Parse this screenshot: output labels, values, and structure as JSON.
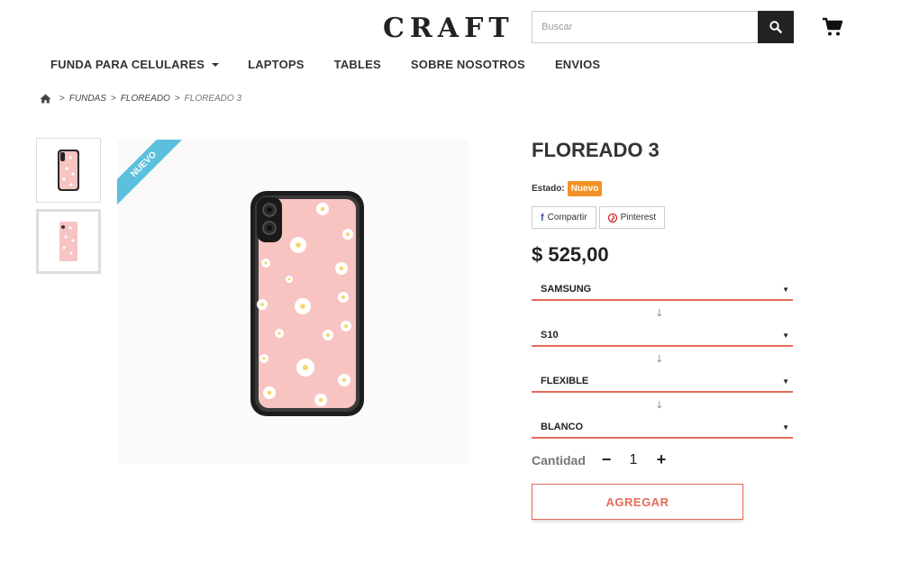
{
  "header": {
    "logo": "CRAFT",
    "search_placeholder": "Buscar",
    "cart_icon": "cart-icon"
  },
  "nav": {
    "items": [
      {
        "label": "FUNDA PARA CELULARES",
        "has_dropdown": true
      },
      {
        "label": "LAPTOPS"
      },
      {
        "label": "TABLES"
      },
      {
        "label": "SOBRE NOSOTROS"
      },
      {
        "label": "ENVIOS"
      }
    ]
  },
  "breadcrumb": {
    "home_icon": "home-icon",
    "separator": ">",
    "items": [
      "FUNDAS",
      "FLOREADO",
      "FLOREADO 3"
    ]
  },
  "product": {
    "ribbon": "NUEVO",
    "title": "FLOREADO 3",
    "estado_label": "Estado:",
    "estado_value": "Nuevo",
    "share_facebook": "Compartir",
    "share_pinterest": "Pinterest",
    "price": "$ 525,00",
    "options": [
      "SAMSUNG",
      "S10",
      "FLEXIBLE",
      "BLANCO"
    ],
    "quantity_label": "Cantidad",
    "quantity": "1",
    "quantity_minus": "−",
    "quantity_plus": "+",
    "add_button": "AGREGAR"
  },
  "colors": {
    "accent": "#e56b5a",
    "badge": "#f29226",
    "ribbon": "#5bc0de",
    "case_pink": "#f7c4c2"
  }
}
